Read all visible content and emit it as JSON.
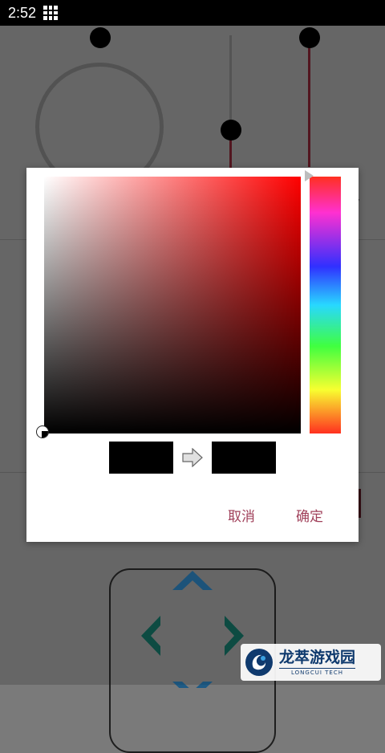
{
  "status_bar": {
    "time": "2:52",
    "grid_icon": "app-grid-icon"
  },
  "background": {
    "side_letter": "y",
    "controls": [
      "ring-slider",
      "vertical-slider",
      "vertical-slider",
      "dpad"
    ],
    "dpad_colors": {
      "vertical": "#1f5b85",
      "horizontal": "#0f5248"
    }
  },
  "color_picker": {
    "hue_color": "#ff0000",
    "old_color": "#000000",
    "new_color": "#000000",
    "cancel_label": "取消",
    "ok_label": "确定",
    "button_color": "#a0405a"
  },
  "watermark": {
    "title": "龙萃游戏园",
    "subtitle": "LONGCUI TECH"
  }
}
